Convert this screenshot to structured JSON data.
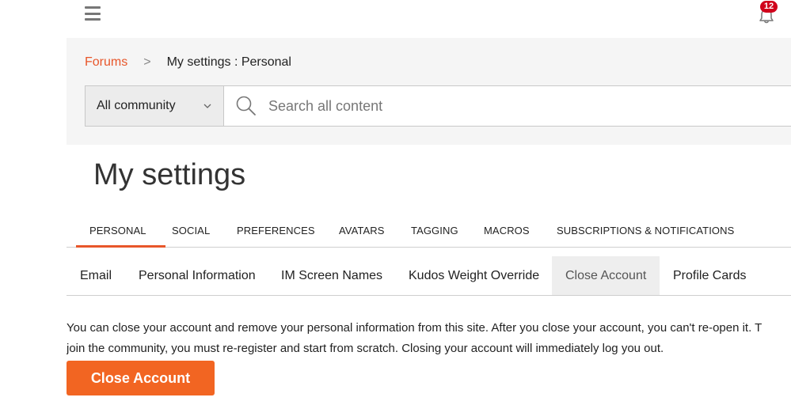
{
  "header": {
    "menu_icon": "hamburger-menu-icon",
    "bell_icon": "bell-icon",
    "notification_count": "12"
  },
  "breadcrumb": {
    "home_label": "Forums",
    "separator": ">",
    "current": "My settings : Personal"
  },
  "search": {
    "scope_value": "All community",
    "scope_icon": "chevron-down-icon",
    "search_icon": "magnifier-icon",
    "placeholder": "Search all content"
  },
  "page": {
    "title": "My settings"
  },
  "tabs": [
    {
      "label": "PERSONAL",
      "active": true
    },
    {
      "label": "SOCIAL"
    },
    {
      "label": "PREFERENCES"
    },
    {
      "label": "AVATARS"
    },
    {
      "label": "TAGGING"
    },
    {
      "label": "MACROS"
    },
    {
      "label": "SUBSCRIPTIONS & NOTIFICATIONS"
    }
  ],
  "subtabs": [
    {
      "label": "Email"
    },
    {
      "label": "Personal Information"
    },
    {
      "label": "IM Screen Names"
    },
    {
      "label": "Kudos Weight Override"
    },
    {
      "label": "Close Account",
      "active": true
    },
    {
      "label": "Profile Cards"
    }
  ],
  "close_account": {
    "description_line1": "You can close your account and remove your personal information from this site. After you close your account, you can't re-open it. T",
    "description_line2": "join the community, you must re-register and start from scratch. Closing your account will immediately log you out.",
    "button_label": "Close Account"
  },
  "colors": {
    "accent": "#e8562a",
    "button": "#f26522",
    "badge": "#d0021b"
  }
}
